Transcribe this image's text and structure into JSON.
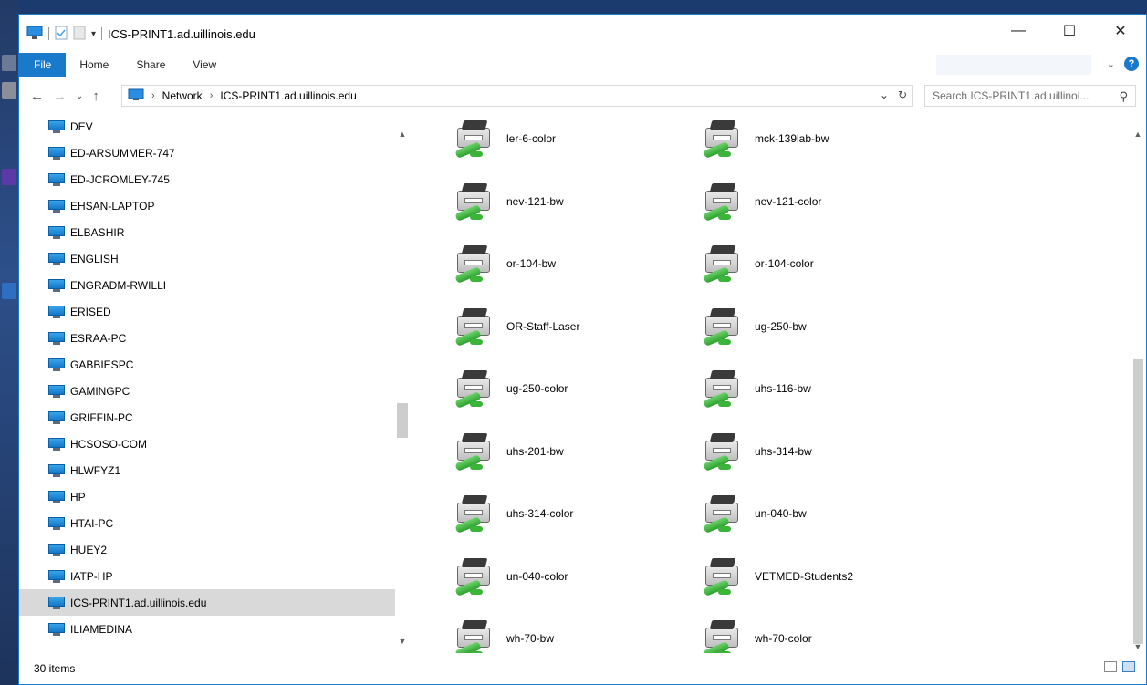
{
  "window": {
    "title": "ICS-PRINT1.ad.uillinois.edu",
    "minimize": "—",
    "maximize": "☐",
    "close": "✕"
  },
  "ribbon": {
    "tabs": [
      "File",
      "Home",
      "Share",
      "View"
    ],
    "help": "?"
  },
  "address": {
    "crumbs": [
      "Network",
      "ICS-PRINT1.ad.uillinois.edu"
    ],
    "search_placeholder": "Search ICS-PRINT1.ad.uillinoi..."
  },
  "nav_items": [
    "DEV",
    "ED-ARSUMMER-747",
    "ED-JCROMLEY-745",
    "EHSAN-LAPTOP",
    "ELBASHIR",
    "ENGLISH",
    "ENGRADM-RWILLI",
    "ERISED",
    "ESRAA-PC",
    "GABBIESPC",
    "GAMINGPC",
    "GRIFFIN-PC",
    "HCSOSO-COM",
    "HLWFYZ1",
    "HP",
    "HTAI-PC",
    "HUEY2",
    "IATP-HP",
    "ICS-PRINT1.ad.uillinois.edu",
    "ILIAMEDINA"
  ],
  "selected_nav": "ICS-PRINT1.ad.uillinois.edu",
  "printers": [
    [
      "ler-6-color",
      "mck-139lab-bw"
    ],
    [
      "nev-121-bw",
      "nev-121-color"
    ],
    [
      "or-104-bw",
      "or-104-color"
    ],
    [
      "OR-Staff-Laser",
      "ug-250-bw"
    ],
    [
      "ug-250-color",
      "uhs-116-bw"
    ],
    [
      "uhs-201-bw",
      "uhs-314-bw"
    ],
    [
      "uhs-314-color",
      "un-040-bw"
    ],
    [
      "un-040-color",
      "VETMED-Students2"
    ],
    [
      "wh-70-bw",
      "wh-70-color"
    ]
  ],
  "status": {
    "count": "30 items"
  },
  "colors": {
    "accent": "#1979ca",
    "selection": "#d9d9d9"
  }
}
